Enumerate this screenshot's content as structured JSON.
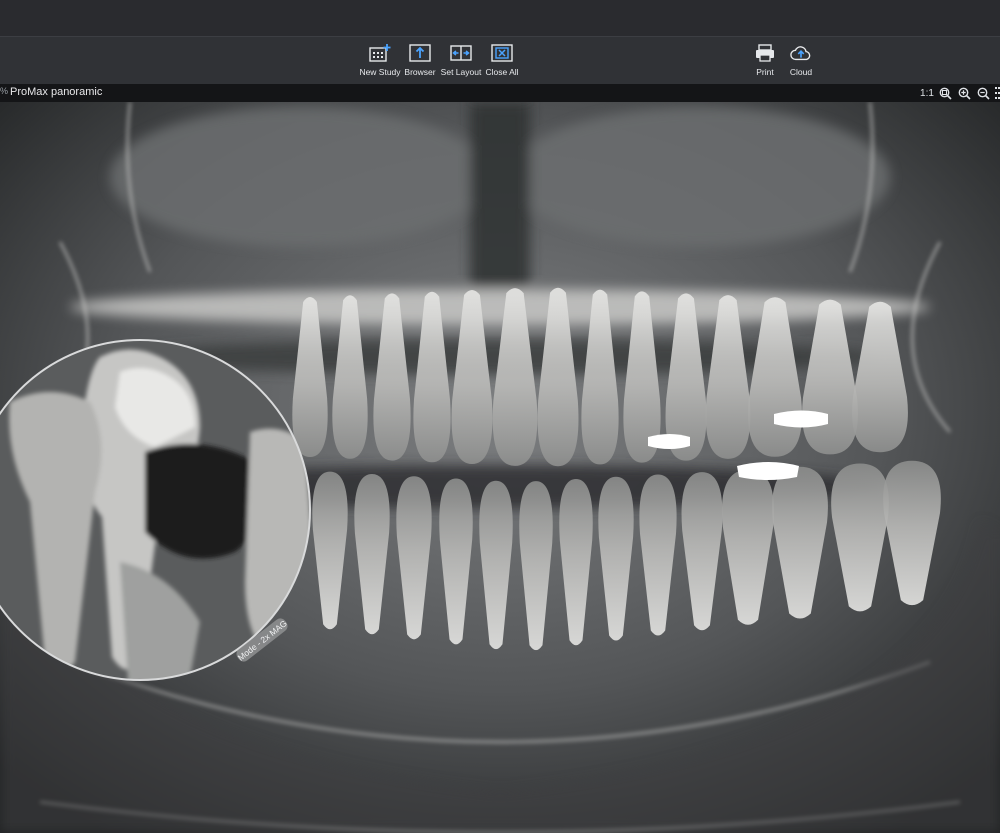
{
  "toolbar": {
    "new_study": "New Study",
    "browser": "Browser",
    "set_layout": "Set Layout",
    "close_all": "Close All",
    "print": "Print",
    "cloud": "Cloud"
  },
  "panel": {
    "edge_mark": "%",
    "title": "ProMax panoramic",
    "zoom_reset": "1:1"
  },
  "magnifier": {
    "mode_label": "Mode - 2x MAG"
  },
  "colors": {
    "accent": "#4aa3ff",
    "toolbar_bg": "#303236",
    "panel_bar_bg": "#141517"
  },
  "icons": [
    "new-study-icon",
    "browser-icon",
    "set-layout-icon",
    "close-all-icon",
    "print-icon",
    "cloud-upload-icon",
    "zoom-fit-icon",
    "zoom-in-icon",
    "zoom-out-icon",
    "grid-icon"
  ]
}
